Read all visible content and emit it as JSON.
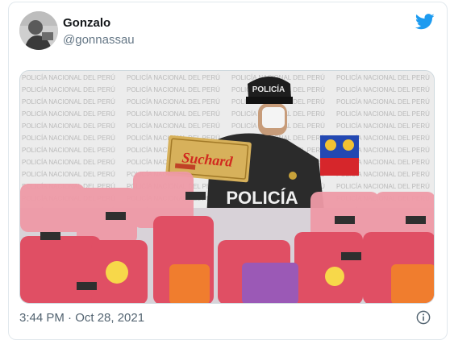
{
  "tweet": {
    "author_name": "Gonzalo",
    "author_handle": "@gonnassau",
    "timestamp": "3:44 PM · Oct 28, 2021"
  },
  "photo": {
    "backdrop_text": "POLICÍA NACIONAL DEL PERÚ",
    "cap_text": "POLICÍA",
    "vest_text": "POLICÍA",
    "box_brand": "Suchard"
  },
  "icons": {
    "twitter": "twitter-bird-icon",
    "info": "info-icon"
  },
  "colors": {
    "twitter_blue": "#1d9bf0",
    "text_primary": "#14171a",
    "text_secondary": "#657786"
  }
}
